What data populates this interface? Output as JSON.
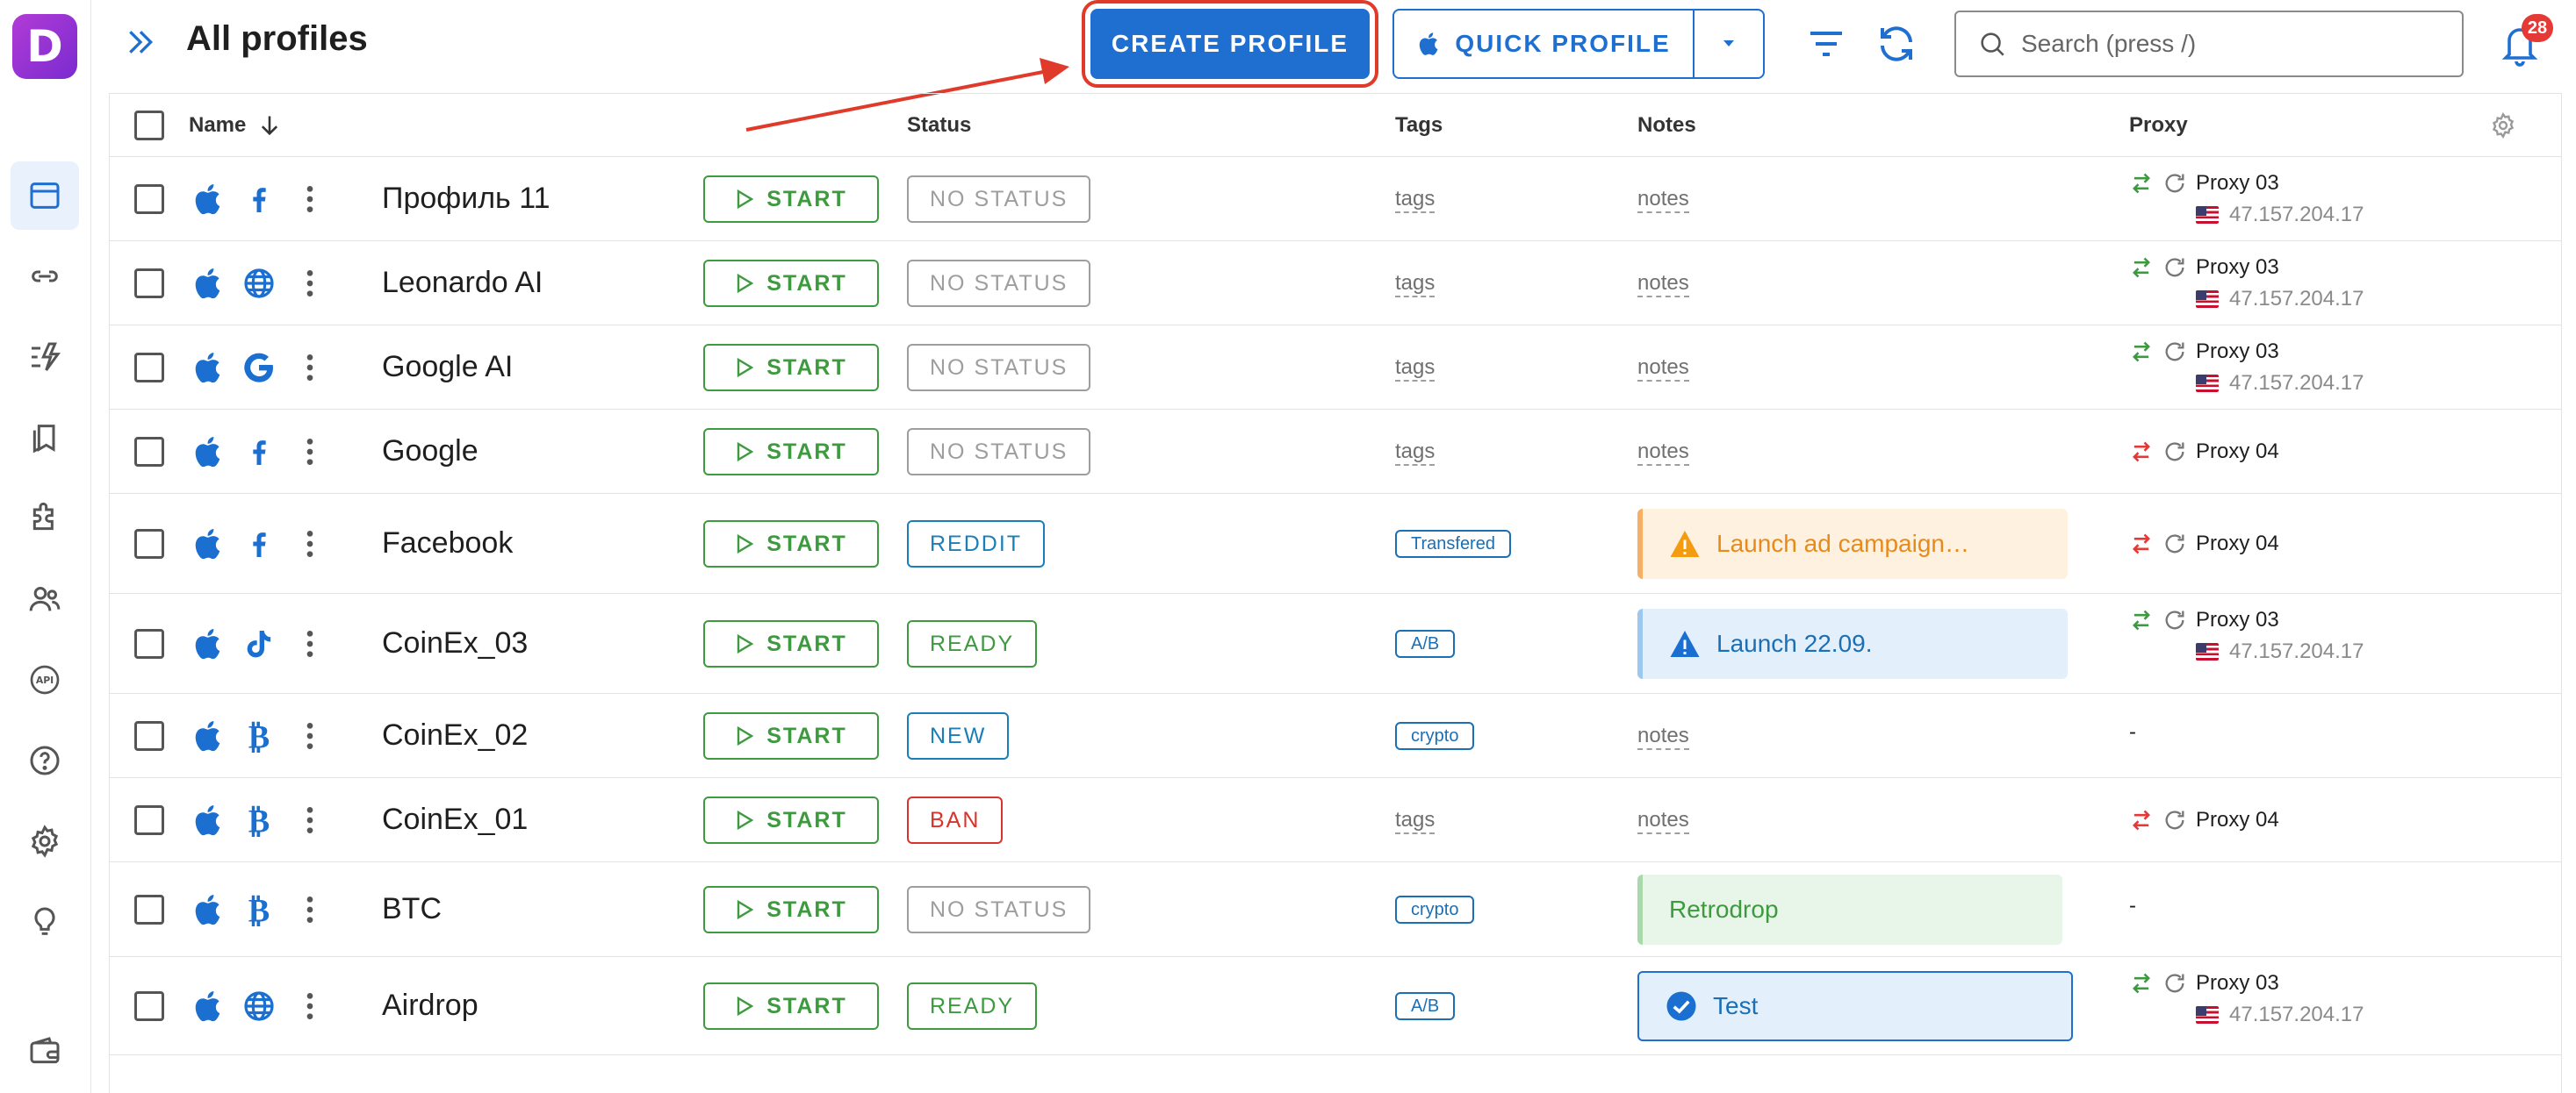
{
  "app": {
    "logo_letter": "D"
  },
  "header": {
    "title": "All profiles",
    "create_label": "CREATE PROFILE",
    "quick_label": "QUICK PROFILE",
    "search_placeholder": "Search (press /)",
    "notifications_count": "28"
  },
  "sidebar": {
    "items": [
      {
        "icon": "browser-window-icon",
        "active": true
      },
      {
        "icon": "link-icon"
      },
      {
        "icon": "automation-icon"
      },
      {
        "icon": "bookmarks-icon"
      },
      {
        "icon": "extension-puzzle-icon"
      },
      {
        "icon": "users-icon"
      },
      {
        "icon": "api-icon"
      },
      {
        "icon": "help-icon"
      },
      {
        "icon": "settings-gear-icon"
      },
      {
        "icon": "lightbulb-icon"
      },
      {
        "icon": "wallet-icon"
      }
    ]
  },
  "table": {
    "columns": {
      "name": "Name",
      "status": "Status",
      "tags": "Tags",
      "notes": "Notes",
      "proxy": "Proxy"
    },
    "start_label": "START",
    "rows": [
      {
        "name": "Профиль 11",
        "site": "facebook",
        "status": "NO STATUS",
        "tags": "tags",
        "notes": "notes",
        "proxy": "Proxy 03",
        "ip": "47.157.204.17",
        "proxy_state": "ok"
      },
      {
        "name": "Leonardo AI",
        "site": "globe",
        "status": "NO STATUS",
        "tags": "tags",
        "notes": "notes",
        "proxy": "Proxy 03",
        "ip": "47.157.204.17",
        "proxy_state": "ok"
      },
      {
        "name": "Google AI",
        "site": "google",
        "status": "NO STATUS",
        "tags": "tags",
        "notes": "notes",
        "proxy": "Proxy 03",
        "ip": "47.157.204.17",
        "proxy_state": "ok"
      },
      {
        "name": "Google",
        "site": "facebook",
        "status": "NO STATUS",
        "tags": "tags",
        "notes": "notes",
        "proxy": "Proxy 04",
        "ip": "",
        "proxy_state": "error"
      },
      {
        "name": "Facebook",
        "site": "facebook",
        "status": "REDDIT",
        "tags": "Transfered",
        "notes": "Launch ad campaign…",
        "note_style": "warning",
        "proxy": "Proxy 04",
        "ip": "",
        "proxy_state": "error"
      },
      {
        "name": "CoinEx_03",
        "site": "tiktok",
        "status": "READY",
        "tags": "A/B",
        "notes": "Launch 22.09.",
        "note_style": "info",
        "proxy": "Proxy 03",
        "ip": "47.157.204.17",
        "proxy_state": "ok"
      },
      {
        "name": "CoinEx_02",
        "site": "bitcoin",
        "status": "NEW",
        "tags": "crypto",
        "notes": "notes",
        "proxy": "-",
        "ip": "",
        "proxy_state": "none"
      },
      {
        "name": "CoinEx_01",
        "site": "bitcoin",
        "status": "BAN",
        "tags": "tags",
        "notes": "notes",
        "proxy": "Proxy 04",
        "ip": "",
        "proxy_state": "error"
      },
      {
        "name": "BTC",
        "site": "bitcoin",
        "status": "NO STATUS",
        "tags": "crypto",
        "notes": "Retrodrop",
        "note_style": "success",
        "proxy": "-",
        "ip": "",
        "proxy_state": "none"
      },
      {
        "name": "Airdrop",
        "site": "globe",
        "status": "READY",
        "tags": "A/B",
        "notes": "Test",
        "note_style": "selected",
        "proxy": "Proxy 03",
        "ip": "47.157.204.17",
        "proxy_state": "ok"
      }
    ]
  },
  "colors": {
    "primary": "#1f6fd1",
    "start_green": "#3d9a3f",
    "ban_red": "#d9332b",
    "annotation_red": "#e03a2a",
    "warning_bg": "#fff1e0",
    "info_bg": "#e3f0fc",
    "success_bg": "#e8f5e9"
  }
}
